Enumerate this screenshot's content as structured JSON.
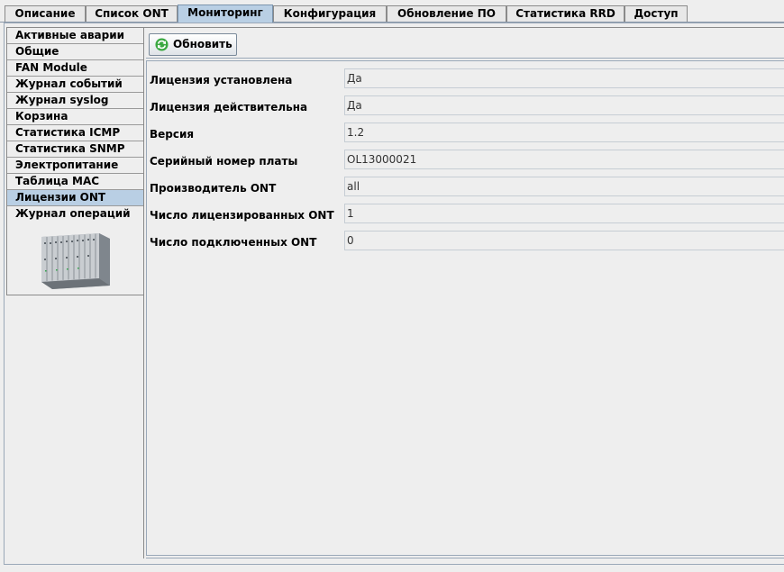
{
  "tabs": [
    {
      "label": "Описание",
      "active": false
    },
    {
      "label": "Список ONT",
      "active": false
    },
    {
      "label": "Мониторинг",
      "active": true
    },
    {
      "label": "Конфигурация",
      "active": false
    },
    {
      "label": "Обновление ПО",
      "active": false
    },
    {
      "label": "Статистика RRD",
      "active": false
    },
    {
      "label": "Доступ",
      "active": false
    }
  ],
  "sidebar": {
    "items": [
      {
        "label": "Активные аварии"
      },
      {
        "label": "Общие"
      },
      {
        "label": "FAN Module"
      },
      {
        "label": "Журнал событий"
      },
      {
        "label": "Журнал syslog"
      },
      {
        "label": "Корзина"
      },
      {
        "label": "Статистика ICMP"
      },
      {
        "label": "Статистика SNMP"
      },
      {
        "label": "Электропитание"
      },
      {
        "label": "Таблица MAC"
      },
      {
        "label": "Лицензии ONT",
        "active": true
      },
      {
        "label": "Журнал операций"
      }
    ],
    "device_icon": "olt-chassis-image"
  },
  "toolbar": {
    "refresh_label": "Обновить",
    "refresh_icon": "refresh-icon"
  },
  "fields": [
    {
      "label": "Лицензия установлена",
      "value": "Да"
    },
    {
      "label": "Лицензия действительна",
      "value": "Да"
    },
    {
      "label": "Версия",
      "value": "1.2"
    },
    {
      "label": "Серийный номер платы",
      "value": "OL13000021"
    },
    {
      "label": "Производитель ONT",
      "value": "all"
    },
    {
      "label": "Число лицензированных ONT",
      "value": "1"
    },
    {
      "label": "Число подключенных ONT",
      "value": "0"
    }
  ],
  "colors": {
    "active_tab": "#b9cfe4",
    "background": "#eeeeee",
    "border": "#9aa8b8"
  }
}
